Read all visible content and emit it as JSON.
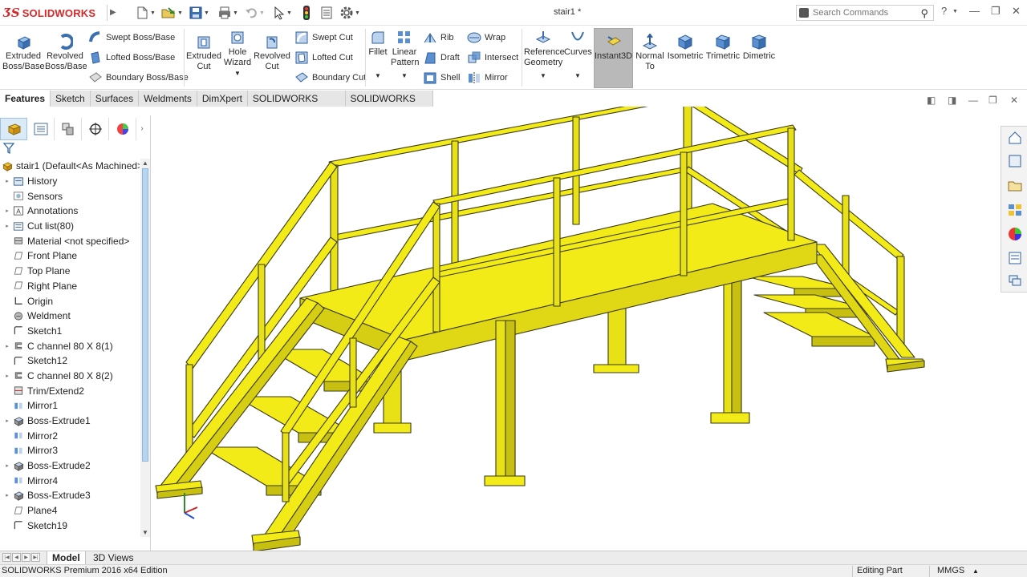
{
  "app": {
    "brand": "SOLIDWORKS",
    "document_title": "stair1 *"
  },
  "search": {
    "placeholder": "Search Commands"
  },
  "ribbon": {
    "extruded_boss": "Extruded Boss/Base",
    "revolved_boss": "Revolved Boss/Base",
    "swept_boss": "Swept Boss/Base",
    "lofted_boss": "Lofted Boss/Base",
    "boundary_boss": "Boundary Boss/Base",
    "extruded_cut": "Extruded Cut",
    "hole_wizard": "Hole Wizard",
    "revolved_cut": "Revolved Cut",
    "swept_cut": "Swept Cut",
    "lofted_cut": "Lofted Cut",
    "boundary_cut": "Boundary Cut",
    "fillet": "Fillet",
    "linear_pattern": "Linear Pattern",
    "rib": "Rib",
    "draft": "Draft",
    "shell": "Shell",
    "wrap": "Wrap",
    "intersect": "Intersect",
    "mirror": "Mirror",
    "reference_geometry": "Reference Geometry",
    "curves": "Curves",
    "instant3d": "Instant3D",
    "normal_to": "Normal To",
    "isometric": "Isometric",
    "trimetric": "Trimetric",
    "dimetric": "Dimetric"
  },
  "command_tabs": [
    "Features",
    "Sketch",
    "Surfaces",
    "Weldments",
    "DimXpert",
    "SOLIDWORKS Add-Ins",
    "SOLIDWORKS MBD"
  ],
  "tree": {
    "root": "stair1  (Default<As Machined>",
    "items": [
      {
        "label": "History",
        "icon": "history-icon",
        "expand": true
      },
      {
        "label": "Sensors",
        "icon": "sensors-icon",
        "expand": false
      },
      {
        "label": "Annotations",
        "icon": "annotations-icon",
        "expand": true
      },
      {
        "label": "Cut list(80)",
        "icon": "cut-list-icon",
        "expand": true
      },
      {
        "label": "Material <not specified>",
        "icon": "material-icon",
        "expand": false
      },
      {
        "label": "Front Plane",
        "icon": "plane-icon",
        "expand": false
      },
      {
        "label": "Top Plane",
        "icon": "plane-icon",
        "expand": false
      },
      {
        "label": "Right Plane",
        "icon": "plane-icon",
        "expand": false
      },
      {
        "label": "Origin",
        "icon": "origin-icon",
        "expand": false
      },
      {
        "label": "Weldment",
        "icon": "weldment-icon",
        "expand": false
      },
      {
        "label": "Sketch1",
        "icon": "sketch-icon",
        "expand": false
      },
      {
        "label": "C channel 80 X 8(1)",
        "icon": "structural-member-icon",
        "expand": true
      },
      {
        "label": "Sketch12",
        "icon": "sketch-icon",
        "expand": false
      },
      {
        "label": "C channel 80 X 8(2)",
        "icon": "structural-member-icon",
        "expand": true
      },
      {
        "label": "Trim/Extend2",
        "icon": "trim-extend-icon",
        "expand": false
      },
      {
        "label": "Mirror1",
        "icon": "mirror-icon",
        "expand": false
      },
      {
        "label": "Boss-Extrude1",
        "icon": "extrude-icon",
        "expand": true
      },
      {
        "label": "Mirror2",
        "icon": "mirror-icon",
        "expand": false
      },
      {
        "label": "Mirror3",
        "icon": "mirror-icon",
        "expand": false
      },
      {
        "label": "Boss-Extrude2",
        "icon": "extrude-icon",
        "expand": true
      },
      {
        "label": "Mirror4",
        "icon": "mirror-icon",
        "expand": false
      },
      {
        "label": "Boss-Extrude3",
        "icon": "extrude-icon",
        "expand": true
      },
      {
        "label": "Plane4",
        "icon": "plane-icon",
        "expand": false
      },
      {
        "label": "Sketch19",
        "icon": "sketch-icon",
        "expand": false
      }
    ]
  },
  "bottom_tabs": {
    "model": "Model",
    "views3d": "3D Views"
  },
  "status": {
    "edition": "SOLIDWORKS Premium 2016 x64 Edition",
    "mode": "Editing Part",
    "units": "MMGS"
  },
  "colors": {
    "brand_red": "#d62828",
    "model_yellow": "#f2eb18",
    "model_outline": "#3a3a1a",
    "tab_active_bg": "#ffffff"
  }
}
